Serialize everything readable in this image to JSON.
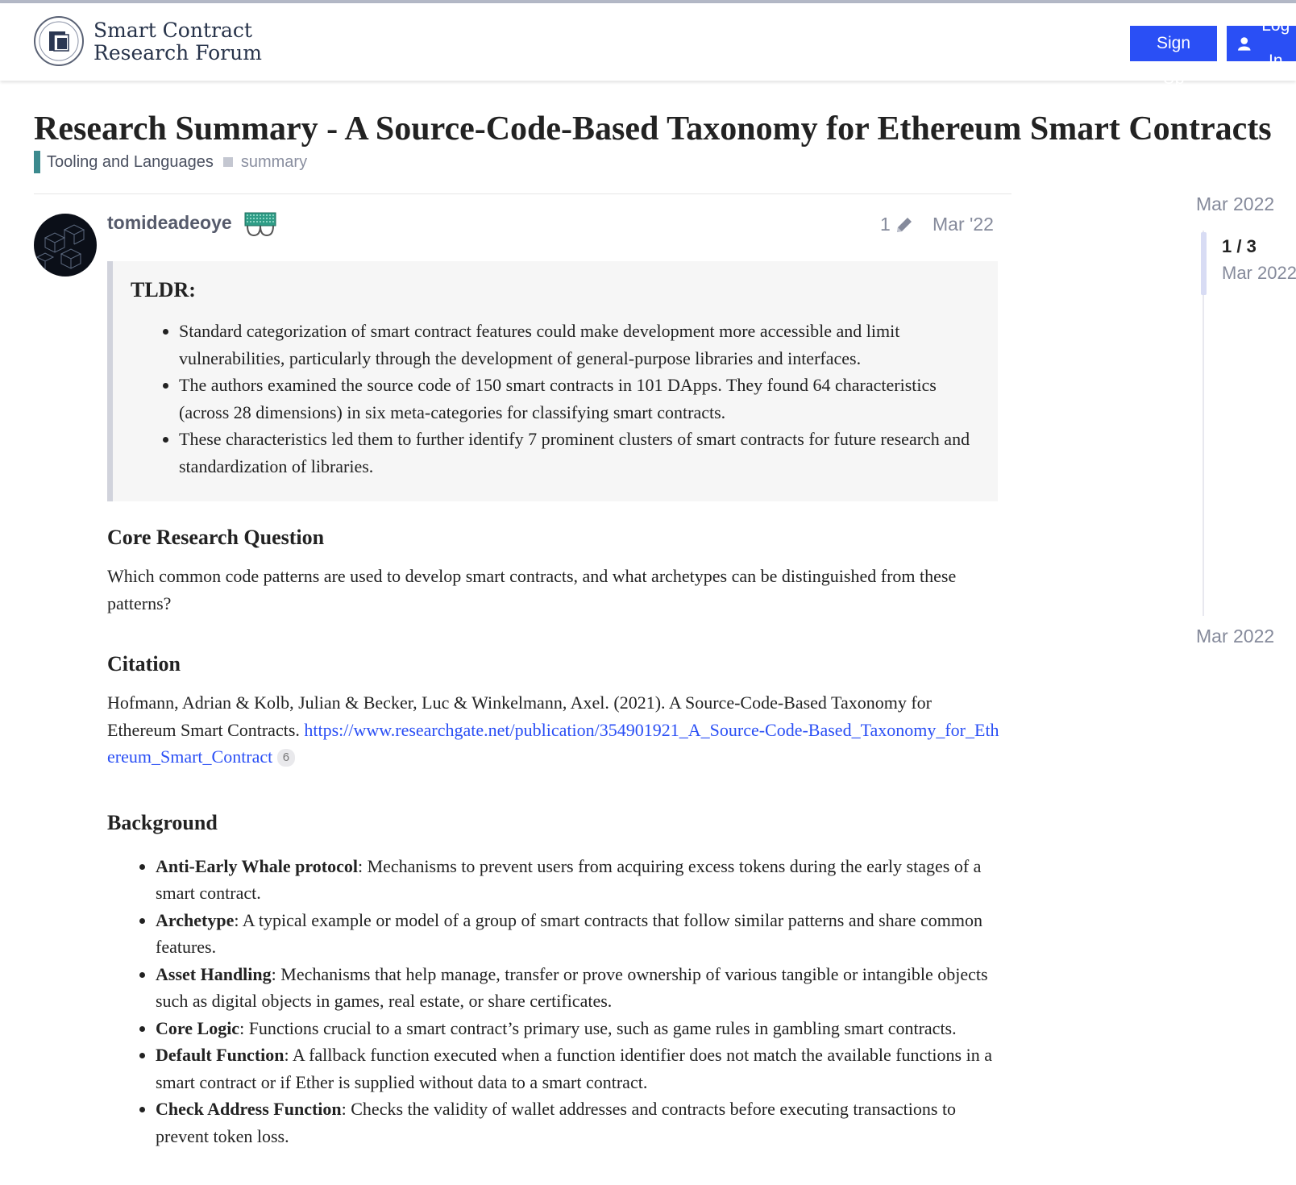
{
  "site": {
    "name_line1": "Smart Contract",
    "name_line2": "Research Forum",
    "sign_up": "Sign Up",
    "log_in": "Log In"
  },
  "topic": {
    "title": "Research Summary - A Source-Code-Based Taxonomy for Ethereum Smart Contracts",
    "category": "Tooling and Languages",
    "tag": "summary"
  },
  "post": {
    "username": "tomideadeoye",
    "edit_count": "1",
    "date": "Mar '22",
    "tldr_heading": "TLDR:",
    "tldr_items": [
      "Standard categorization of smart contract features could make development more accessible and limit vulnerabilities, particularly through the development of general-purpose libraries and interfaces.",
      "The authors examined the source code of 150 smart contracts in 101 DApps. They found 64 characteristics (across 28 dimensions) in six meta-categories for classifying smart contracts.",
      "These characteristics led them to further identify 7 prominent clusters of smart contracts for future research and standardization of libraries."
    ],
    "crq_heading": "Core Research Question",
    "crq_text": "Which common code patterns are used to develop smart contracts, and what archetypes can be distinguished from these patterns?",
    "citation_heading": "Citation",
    "citation_text": "Hofmann, Adrian & Kolb, Julian & Becker, Luc & Winkelmann, Axel. (2021). A Source-Code-Based Taxonomy for Ethereum Smart Contracts.",
    "citation_link": "https://www.researchgate.net/publication/354901921_A_Source-Code-Based_Taxonomy_for_Ethereum_Smart_Contract",
    "citation_clicks": "6",
    "background_heading": "Background",
    "background_items": [
      {
        "term": "Anti-Early Whale protocol",
        "desc": ": Mechanisms to prevent users from acquiring excess tokens during the early stages of a smart contract."
      },
      {
        "term": "Archetype",
        "desc": ": A typical example or model of a group of smart contracts that follow similar patterns and share common features."
      },
      {
        "term": "Asset Handling",
        "desc": ": Mechanisms that help manage, transfer or prove ownership of various tangible or intangible objects such as digital objects in games, real estate, or share certificates."
      },
      {
        "term": "Core Logic",
        "desc": ": Functions crucial to a smart contract’s primary use, such as game rules in gambling smart contracts."
      },
      {
        "term": "Default Function",
        "desc": ": A fallback function executed when a function identifier does not match the available functions in a smart contract or if Ether is supplied without data to a smart contract."
      },
      {
        "term": "Check Address Function",
        "desc": ": Checks the validity of wallet addresses and contracts before executing transactions to prevent token loss."
      }
    ]
  },
  "timeline": {
    "start": "Mar 2022",
    "position": "1 / 3",
    "current_date": "Mar 2022",
    "end": "Mar 2022"
  },
  "colors": {
    "accent": "#2a4ff5",
    "category": "#3c8a8e"
  }
}
